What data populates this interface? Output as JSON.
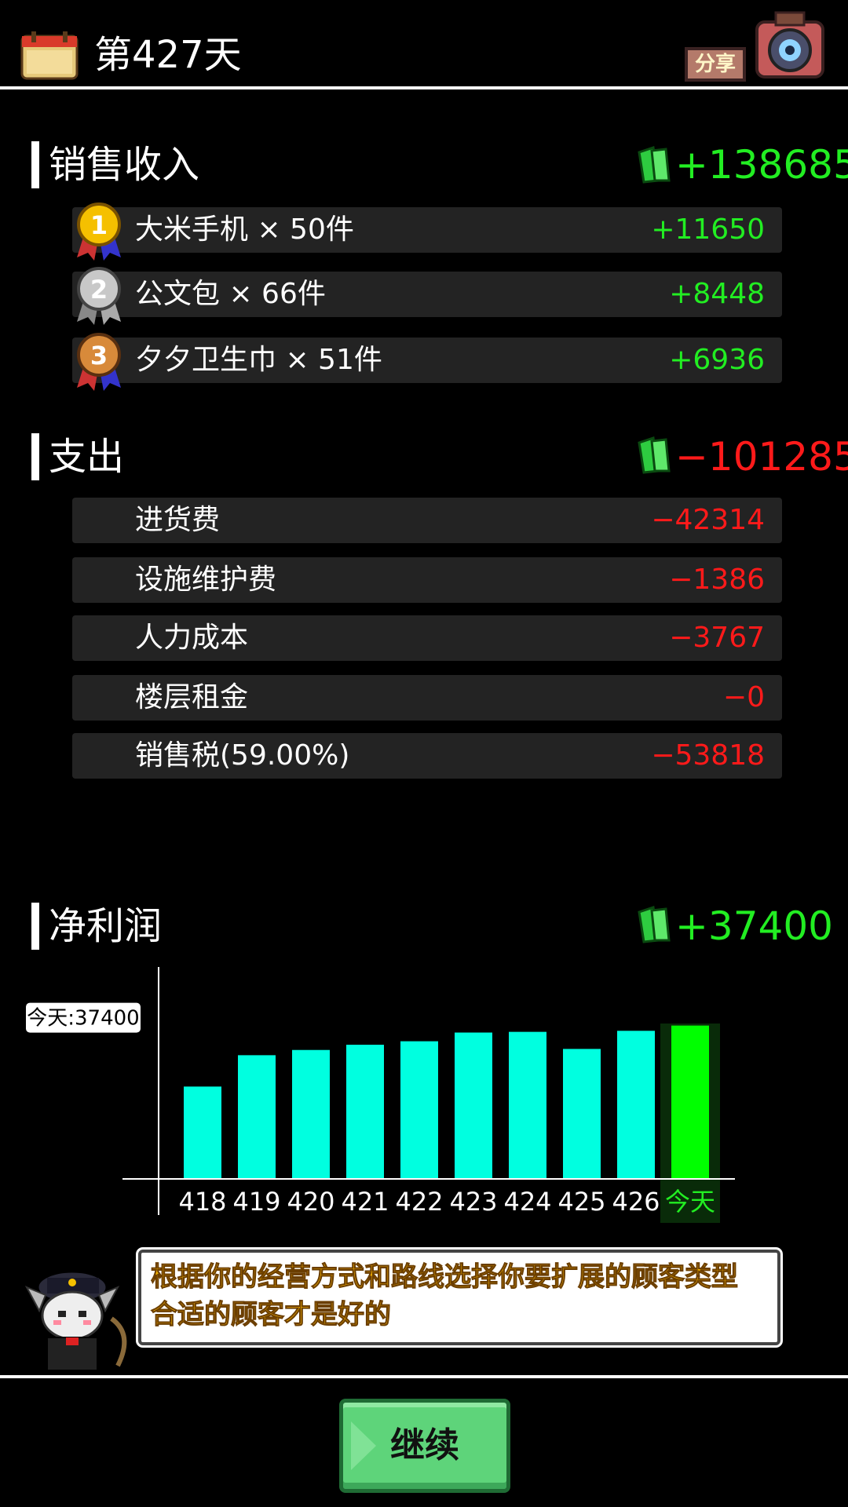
{
  "header": {
    "day_title": "第427天",
    "share_label": "分享"
  },
  "colors": {
    "positive": "#22ee22",
    "negative": "#ff1a1a",
    "bar": "#00ffe0",
    "bar_today": "#00ff00",
    "message_text": "#f5b300"
  },
  "income": {
    "title": "销售收入",
    "total": "+138685",
    "items": [
      {
        "rank": "1",
        "label": "大米手机 × 50件",
        "value": "+11650",
        "medal": "gold-medal-icon"
      },
      {
        "rank": "2",
        "label": "公文包 × 66件",
        "value": "+8448",
        "medal": "silver-medal-icon"
      },
      {
        "rank": "3",
        "label": "夕夕卫生巾 × 51件",
        "value": "+6936",
        "medal": "bronze-medal-icon"
      }
    ]
  },
  "expenses": {
    "title": "支出",
    "total": "−101285",
    "items": [
      {
        "label": "进货费",
        "value": "−42314"
      },
      {
        "label": "设施维护费",
        "value": "−1386"
      },
      {
        "label": "人力成本",
        "value": "−3767"
      },
      {
        "label": "楼层租金",
        "value": "−0"
      },
      {
        "label": "销售税(59.00%)",
        "value": "−53818"
      }
    ]
  },
  "profit": {
    "title": "净利润",
    "total": "+37400"
  },
  "chart_data": {
    "type": "bar",
    "categories": [
      "418",
      "419",
      "420",
      "421",
      "422",
      "423",
      "424",
      "425",
      "426",
      "今天"
    ],
    "values": [
      26500,
      35500,
      37000,
      38500,
      39500,
      42000,
      42200,
      37300,
      42500,
      44000
    ],
    "highlight_label": "今天:37400",
    "ylim": [
      0,
      50000
    ],
    "grid": false
  },
  "message": {
    "line1": "根据你的经营方式和路线选择你要扩展的顾客类型",
    "line2": "合适的顾客才是好的"
  },
  "continue_label": "继续"
}
